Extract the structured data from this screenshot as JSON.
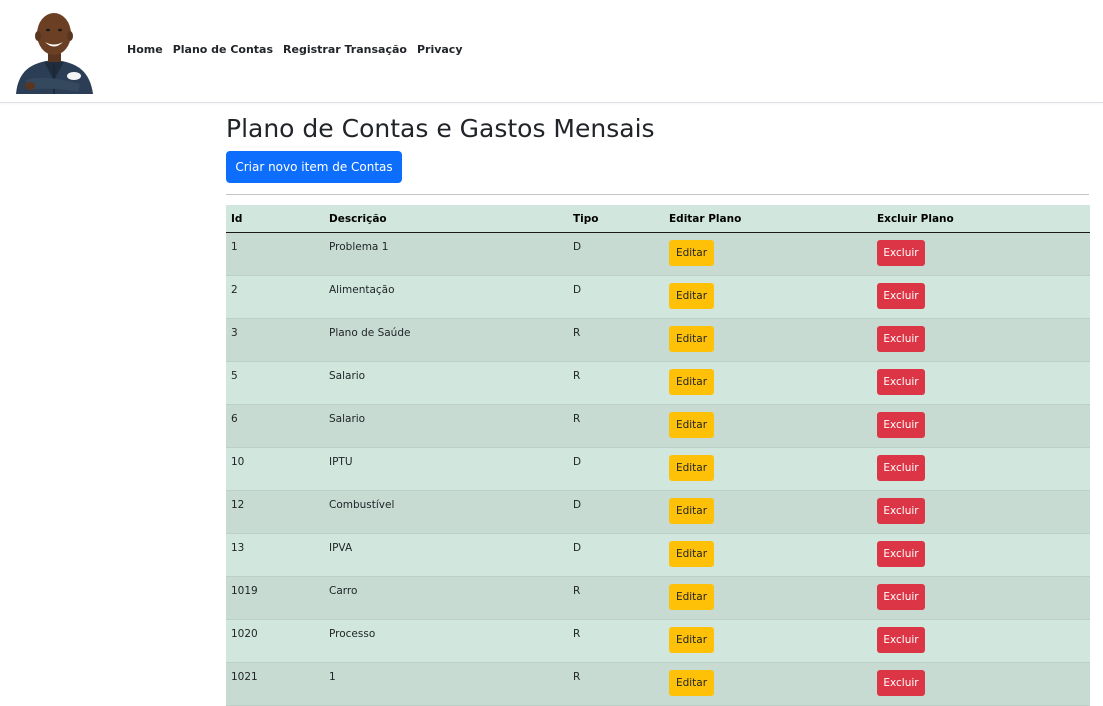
{
  "nav": {
    "links": [
      "Home",
      "Plano de Contas",
      "Registrar Transação",
      "Privacy"
    ]
  },
  "main": {
    "title": "Plano de Contas e Gastos Mensais",
    "create_button": "Criar novo item de Contas"
  },
  "table": {
    "headers": [
      "Id",
      "Descrição",
      "Tipo",
      "Editar Plano",
      "Excluir Plano"
    ],
    "edit_label": "Editar",
    "delete_label": "Excluir",
    "rows": [
      {
        "id": "1",
        "descricao": "Problema 1",
        "tipo": "D"
      },
      {
        "id": "2",
        "descricao": "Alimentação",
        "tipo": "D"
      },
      {
        "id": "3",
        "descricao": "Plano de Saúde",
        "tipo": "R"
      },
      {
        "id": "5",
        "descricao": "Salario",
        "tipo": "R"
      },
      {
        "id": "6",
        "descricao": "Salario",
        "tipo": "R"
      },
      {
        "id": "10",
        "descricao": "IPTU",
        "tipo": "D"
      },
      {
        "id": "12",
        "descricao": "Combustível",
        "tipo": "D"
      },
      {
        "id": "13",
        "descricao": "IPVA",
        "tipo": "D"
      },
      {
        "id": "1019",
        "descricao": "Carro",
        "tipo": "R"
      },
      {
        "id": "1020",
        "descricao": "Processo",
        "tipo": "R"
      },
      {
        "id": "1021",
        "descricao": "1",
        "tipo": "R"
      }
    ]
  },
  "colors": {
    "primary": "#0d6efd",
    "warning": "#ffc107",
    "danger": "#dc3545",
    "table_bg": "#d1e7dd",
    "table_stripe": "#c7dbd2"
  }
}
